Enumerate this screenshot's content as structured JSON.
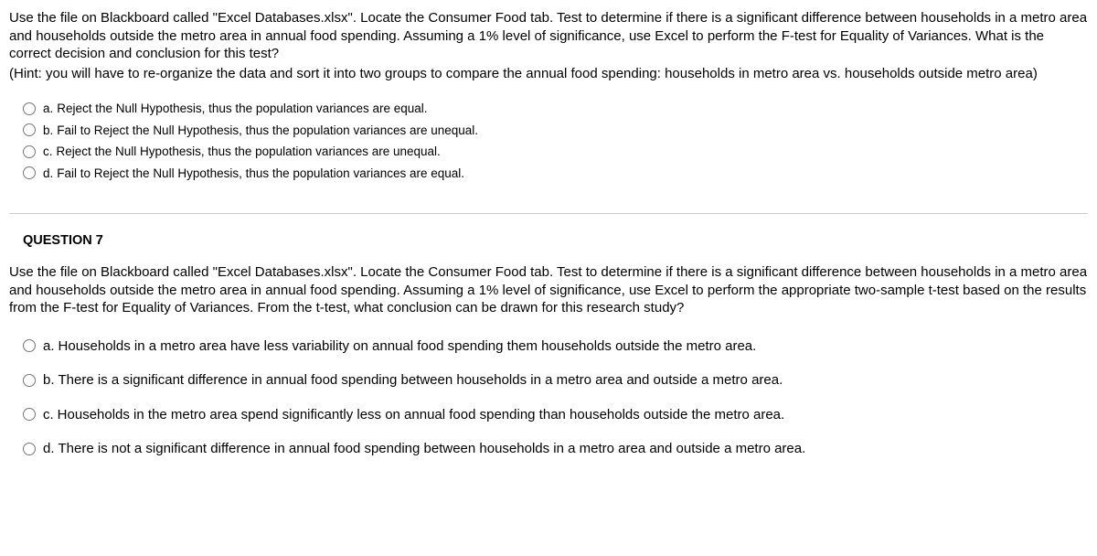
{
  "question6": {
    "text_line1": "Use the file on Blackboard called \"Excel Databases.xlsx\".  Locate the Consumer Food tab.  Test to determine if there is a significant difference between households in a metro area and households outside the metro area in annual food spending.  Assuming a 1% level of significance, use Excel to perform the F-test for Equality of Variances.  What is the correct decision and conclusion for this test?",
    "hint": "(Hint:  you will have to re-organize the data and sort it into two groups to compare the annual food spending:  households in metro area vs. households outside metro area)",
    "options": [
      {
        "prefix": "a.",
        "text": "Reject the Null Hypothesis, thus the population variances are equal."
      },
      {
        "prefix": "b.",
        "text": "Fail to Reject the Null Hypothesis, thus the population variances are unequal."
      },
      {
        "prefix": "c.",
        "text": "Reject the Null Hypothesis, thus the population variances are unequal."
      },
      {
        "prefix": "d.",
        "text": "Fail to Reject the Null Hypothesis, thus the population variances are equal."
      }
    ]
  },
  "question7": {
    "header": "QUESTION 7",
    "text": "Use the file on Blackboard called \"Excel Databases.xlsx\".  Locate the Consumer Food tab.  Test to determine if there is a significant difference between households in a metro area and households outside the metro area in annual food spending.  Assuming a 1% level of significance, use Excel to perform the appropriate two-sample t-test based on the results from the F-test for Equality of Variances.  From the t-test, what conclusion can be drawn for this research study?",
    "options": [
      {
        "prefix": "a.",
        "text": "Households in a metro area have less variability on annual food spending them households outside the metro area."
      },
      {
        "prefix": "b.",
        "text": "There is a significant difference in annual food spending between households in a metro area and outside a metro area."
      },
      {
        "prefix": "c.",
        "text": "Households in the metro area spend significantly less on annual food spending than households outside the metro area."
      },
      {
        "prefix": "d.",
        "text": "There is not a significant difference in annual food spending between households in a metro area and outside a metro area."
      }
    ]
  }
}
